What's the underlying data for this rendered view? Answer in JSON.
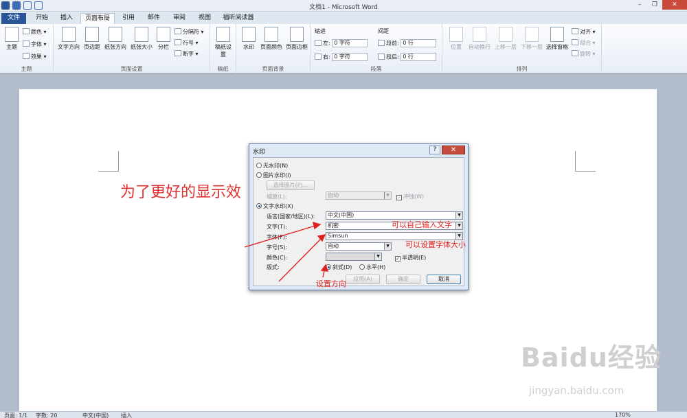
{
  "window": {
    "title": "文档1 - Microsoft Word"
  },
  "tabs": [
    "文件",
    "开始",
    "插入",
    "页面布局",
    "引用",
    "邮件",
    "审阅",
    "视图",
    "福昕阅读器"
  ],
  "ribbon": {
    "theme_group": {
      "label": "主题",
      "theme_btn": "主题",
      "colors": "颜色",
      "fonts": "字体",
      "effects": "效果"
    },
    "page_setup": {
      "label": "页面设置",
      "text_dir": "文字方向",
      "margins": "页边距",
      "orientation": "纸张方向",
      "size": "纸张大小",
      "columns": "分栏",
      "breaks": "分隔符",
      "line_numbers": "行号",
      "hyphenation": "断字"
    },
    "draft": {
      "label": "稿纸",
      "btn": "稿纸设置"
    },
    "page_background": {
      "label": "页面背景",
      "watermark": "水印",
      "page_color": "页面颜色",
      "page_border": "页面边框"
    },
    "paragraph": {
      "label": "段落",
      "indent": "缩进",
      "spacing": "间距",
      "left": "左:",
      "right": "右:",
      "before": "段前:",
      "after": "段后:",
      "left_val": "0 字符",
      "right_val": "0 字符",
      "before_val": "0 行",
      "after_val": "0 行"
    },
    "arrange": {
      "label": "排列",
      "position": "位置",
      "wrap": "自动换行",
      "forward": "上移一层",
      "backward": "下移一层",
      "selection": "选择窗格",
      "align": "对齐",
      "group": "组合",
      "rotate": "旋转"
    }
  },
  "document": {
    "body_text": "为了更好的显示效"
  },
  "watermark": {
    "logo": "Baidu经验",
    "url": "jingyan.baidu.com"
  },
  "dialog": {
    "title": "水印",
    "help": "?",
    "close": "✕",
    "no_watermark": "无水印(N)",
    "picture_watermark": "图片水印(I)",
    "select_picture": "选择图片(P)...",
    "scale_label": "缩放(L):",
    "scale_value": "自动",
    "washout": "冲蚀(W)",
    "text_watermark": "文字水印(X)",
    "language_label": "语言(国家/地区)(L):",
    "language_value": "中文(中国)",
    "text_label": "文字(T):",
    "text_value": "机密",
    "font_label": "字体(F):",
    "font_value": "Simsun",
    "size_label": "字号(S):",
    "size_value": "自动",
    "color_label": "颜色(C):",
    "semitransparent": "半透明(E)",
    "layout_label": "版式:",
    "diagonal": "斜式(D)",
    "horizontal": "水平(H)",
    "apply": "应用(A)",
    "ok": "确定",
    "cancel": "取消"
  },
  "annotations": {
    "custom_text": "可以自己输入文字",
    "font_size": "可以设置字体大小",
    "direction": "设置方向",
    "color": "#e02020"
  },
  "statusbar": {
    "page": "页面: 1/1",
    "words": "字数: 20",
    "language": "中文(中国)",
    "mode": "插入",
    "zoom": "170%"
  }
}
